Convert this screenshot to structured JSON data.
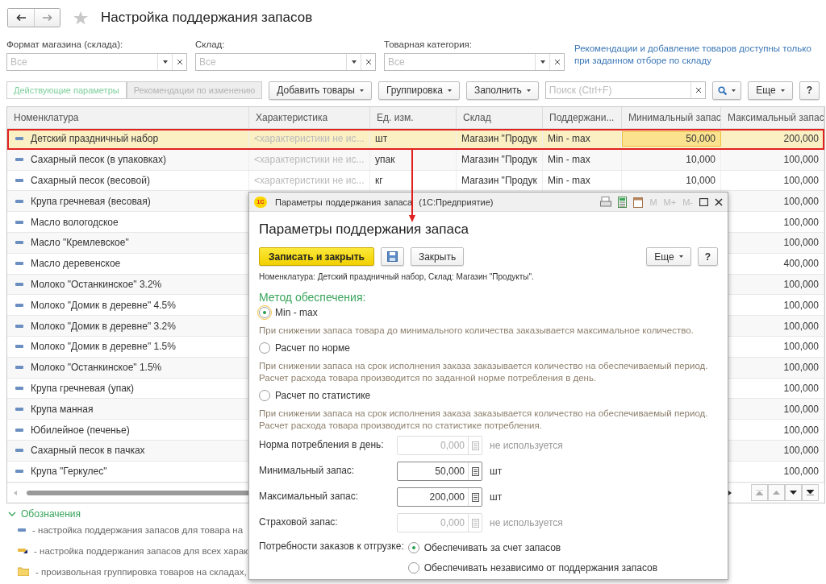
{
  "window": {
    "title": "Настройка поддержания запасов"
  },
  "filters": [
    {
      "label": "Формат магазина (склада):",
      "placeholder": "Все"
    },
    {
      "label": "Склад:",
      "placeholder": "Все"
    },
    {
      "label": "Товарная категория:",
      "placeholder": "Все"
    }
  ],
  "filter_hint": "Рекомендации и добавление товаров доступны только при заданном отборе по складу",
  "toolbar": {
    "tabs": [
      {
        "label": "Действующие параметры",
        "selected": true
      },
      {
        "label": "Рекомендации по изменению",
        "selected": false
      }
    ],
    "buttons": [
      "Добавить товары",
      "Группировка",
      "Заполнить"
    ],
    "search": {
      "placeholder": "Поиск (Ctrl+F)"
    },
    "more": "Еще",
    "help": "?"
  },
  "table": {
    "columns": [
      "Номенклатура",
      "Характеристика",
      "Ед. изм.",
      "Склад",
      "Поддержани...",
      "Минимальный запас",
      "Максимальный запас"
    ],
    "rows": [
      {
        "name": "Детский праздничный набор",
        "characteristic": "<характеристики не ис...",
        "unit": "шт",
        "warehouse": "Магазин \"Продук",
        "method": "Min - max",
        "min": "50,000",
        "max": "200,000",
        "selected": true
      },
      {
        "name": "Сахарный песок (в упаковках)",
        "characteristic": "<характеристики не ис...",
        "unit": "упак",
        "warehouse": "Магазин \"Продук",
        "method": "Min - max",
        "min": "10,000",
        "max": "100,000",
        "selected": false
      },
      {
        "name": "Сахарный песок (весовой)",
        "characteristic": "<характеристики не ис...",
        "unit": "кг",
        "warehouse": "Магазин \"Продук",
        "method": "Min - max",
        "min": "10,000",
        "max": "100,000",
        "selected": false
      },
      {
        "name": "Крупа гречневая (весовая)",
        "max": "100,000",
        "selected": false
      },
      {
        "name": "Масло вологодское",
        "max": "100,000",
        "selected": false
      },
      {
        "name": "Масло \"Кремлевское\"",
        "max": "100,000",
        "selected": false
      },
      {
        "name": "Масло деревенское",
        "max": "400,000",
        "selected": false
      },
      {
        "name": "Молоко \"Останкинское\" 3.2%",
        "max": "100,000",
        "selected": false
      },
      {
        "name": "Молоко \"Домик в деревне\" 4.5%",
        "max": "100,000",
        "selected": false
      },
      {
        "name": "Молоко \"Домик в деревне\" 3.2%",
        "max": "100,000",
        "selected": false
      },
      {
        "name": "Молоко \"Домик в деревне\" 1.5%",
        "max": "100,000",
        "selected": false
      },
      {
        "name": "Молоко \"Останкинское\" 1.5%",
        "max": "100,000",
        "selected": false
      },
      {
        "name": "Крупа гречневая (упак)",
        "max": "100,000",
        "selected": false
      },
      {
        "name": "Крупа манная",
        "max": "100,000",
        "selected": false
      },
      {
        "name": "Юбилейное (печенье)",
        "max": "100,000",
        "selected": false
      },
      {
        "name": "Сахарный песок в пачках",
        "max": "100,000",
        "selected": false
      },
      {
        "name": "Крупа \"Геркулес\"",
        "max": "100,000",
        "selected": false
      }
    ]
  },
  "legend": {
    "title": "Обозначения",
    "expanded": true,
    "items": [
      {
        "kind": "item",
        "text": "- настройка поддержания запасов для товара на"
      },
      {
        "kind": "all",
        "text": "- настройка поддержания запасов для всех харак"
      },
      {
        "kind": "group",
        "text": "- произвольная группировка товаров на складах,"
      }
    ]
  },
  "dialog": {
    "logo": "1С",
    "title": "Параметры поддержания запаса  (1С:Предприятие)",
    "memory_buttons": [
      "M",
      "M+",
      "M-"
    ],
    "heading": "Параметры поддержания запаса",
    "save_close": "Записать и закрыть",
    "close": "Закрыть",
    "more": "Еще",
    "help": "?",
    "info": "Номенклатура: Детский праздничный набор, Склад: Магазин \"Продукты\".",
    "method_label": "Метод обеспечения:",
    "methods": [
      {
        "label": "Min - max",
        "selected": true,
        "description": "При снижении запаса товара до минимального количества заказывается максимальное количество."
      },
      {
        "label": "Расчет по норме",
        "selected": false,
        "description": "При снижении запаса на срок исполнения заказа заказывается количество на обеспечиваемый период. Расчет расхода товара производится по заданной норме потребления в день."
      },
      {
        "label": "Расчет по статистике",
        "selected": false,
        "description": "При снижении запаса на срок исполнения заказа заказывается количество на обеспечиваемый период. Расчет расхода товара производится по статистике потребления."
      }
    ],
    "fields": [
      {
        "label": "Норма потребления в день:",
        "value": "0,000",
        "unit": "не используется",
        "disabled": true
      },
      {
        "label": "Минимальный запас:",
        "value": "50,000",
        "unit": "шт",
        "disabled": false
      },
      {
        "label": "Максимальный запас:",
        "value": "200,000",
        "unit": "шт",
        "disabled": false
      },
      {
        "label": "Страховой запас:",
        "value": "0,000",
        "unit": "не используется",
        "disabled": true
      }
    ],
    "shipment": {
      "label": "Потребности заказов к отгрузке:",
      "options": [
        {
          "label": "Обеспечивать за счет запасов",
          "selected": true
        },
        {
          "label": "Обеспечивать независимо от поддержания запасов",
          "selected": false
        }
      ]
    }
  }
}
